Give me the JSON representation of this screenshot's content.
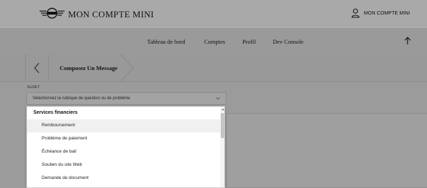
{
  "header": {
    "brand_title": "MON COMPTE MINI",
    "logo_icon": "mini-logo-icon",
    "user_icon": "user-icon",
    "user_label": "MON COMPTE MINI"
  },
  "nav": {
    "items": [
      {
        "label": "Tableau de bord"
      },
      {
        "label": "Comptes"
      },
      {
        "label": "Profil"
      },
      {
        "label": "Dev Console"
      }
    ],
    "scroll_top_icon": "arrow-up-icon"
  },
  "breadcrumb": {
    "back_icon": "chevron-left-icon",
    "current": "Composez Un Message"
  },
  "form": {
    "subject_label": "SUJET",
    "subject_placeholder": "Sélectionnez la rubrique de question ou de problème",
    "chevron_icon": "chevron-down-icon"
  },
  "dropdown": {
    "group": "Services financiers",
    "options": [
      {
        "label": "Remboursement",
        "hover": true
      },
      {
        "label": "Problème de paiement"
      },
      {
        "label": "Échéance de bail"
      },
      {
        "label": "Soutien du site Web"
      },
      {
        "label": "Demande de document"
      }
    ]
  },
  "colors": {
    "overlay": "#9c9c9c",
    "dropdown_bg": "#ffffff",
    "hover_bg": "#f0f0f0"
  }
}
